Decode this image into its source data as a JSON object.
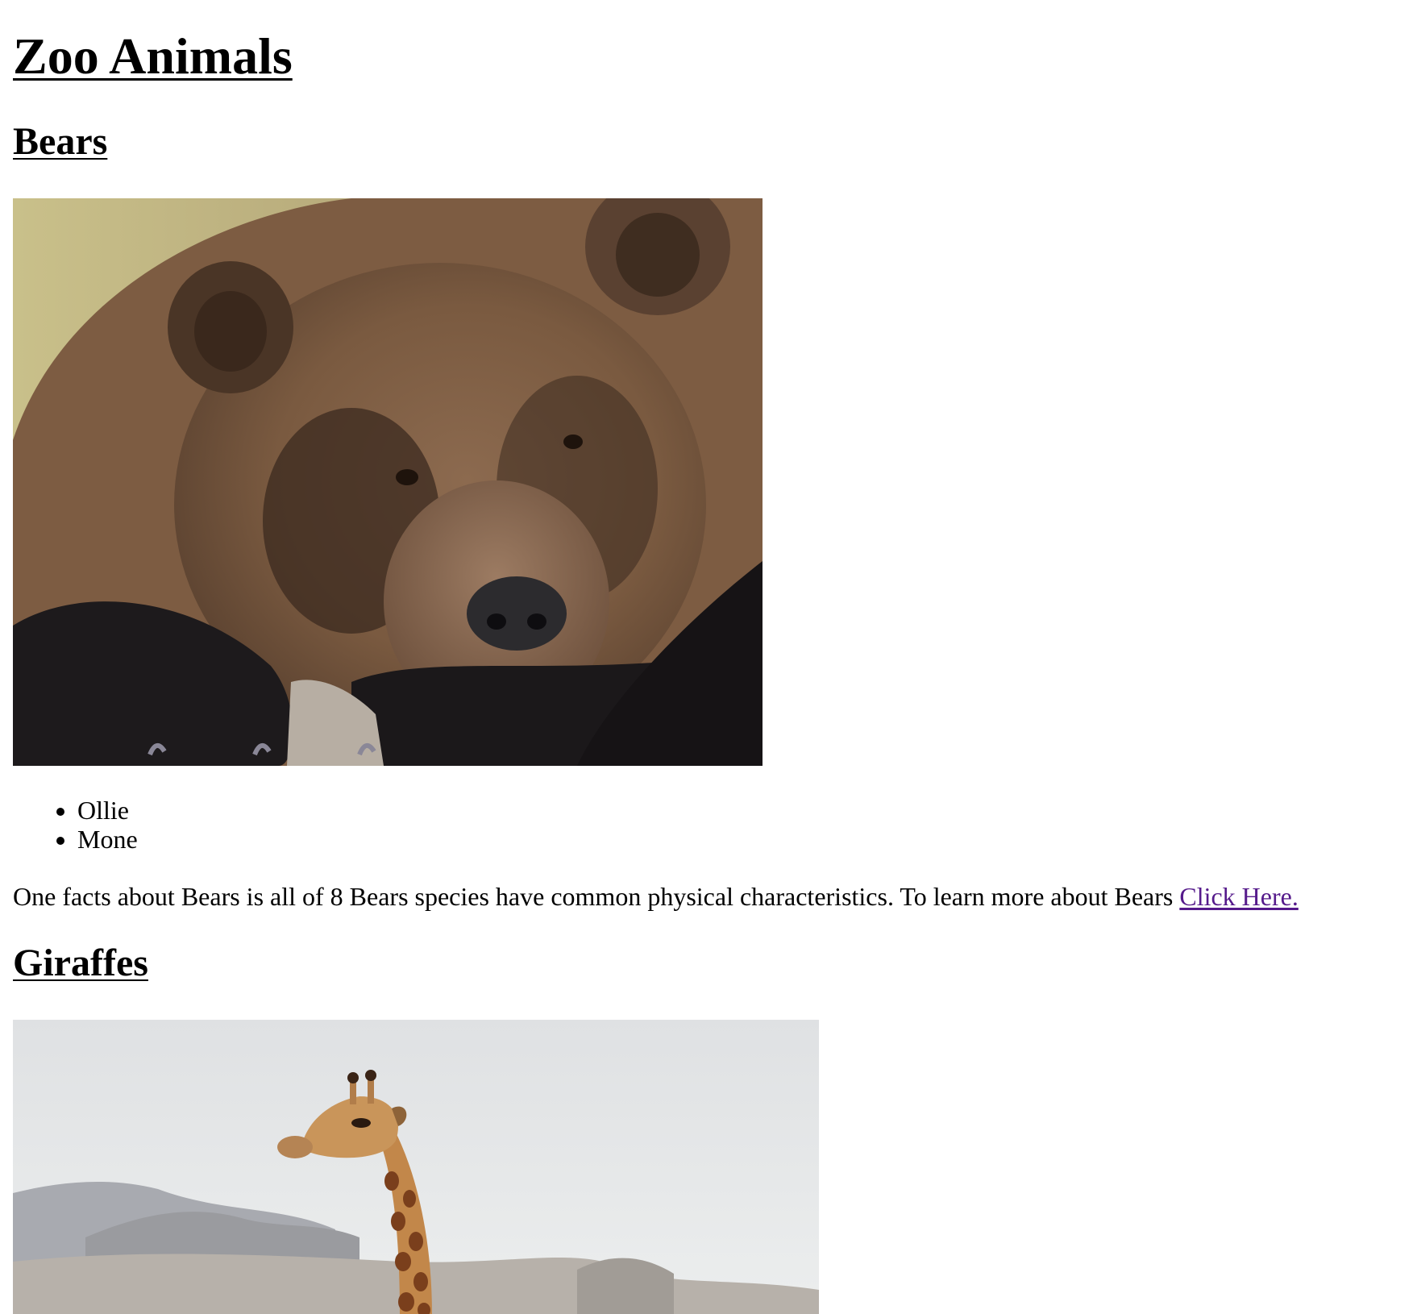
{
  "page": {
    "title": "Zoo Animals"
  },
  "bears": {
    "heading": "Bears",
    "names": [
      "Ollie",
      "Mone"
    ],
    "fact_text": "One facts about Bears is all of 8 Bears species have common physical characteristics. To learn more about Bears ",
    "link_label": "Click Here."
  },
  "giraffes": {
    "heading": "Giraffes"
  },
  "colors": {
    "visited_link": "#551a8b",
    "text": "#000000",
    "background": "#ffffff"
  }
}
